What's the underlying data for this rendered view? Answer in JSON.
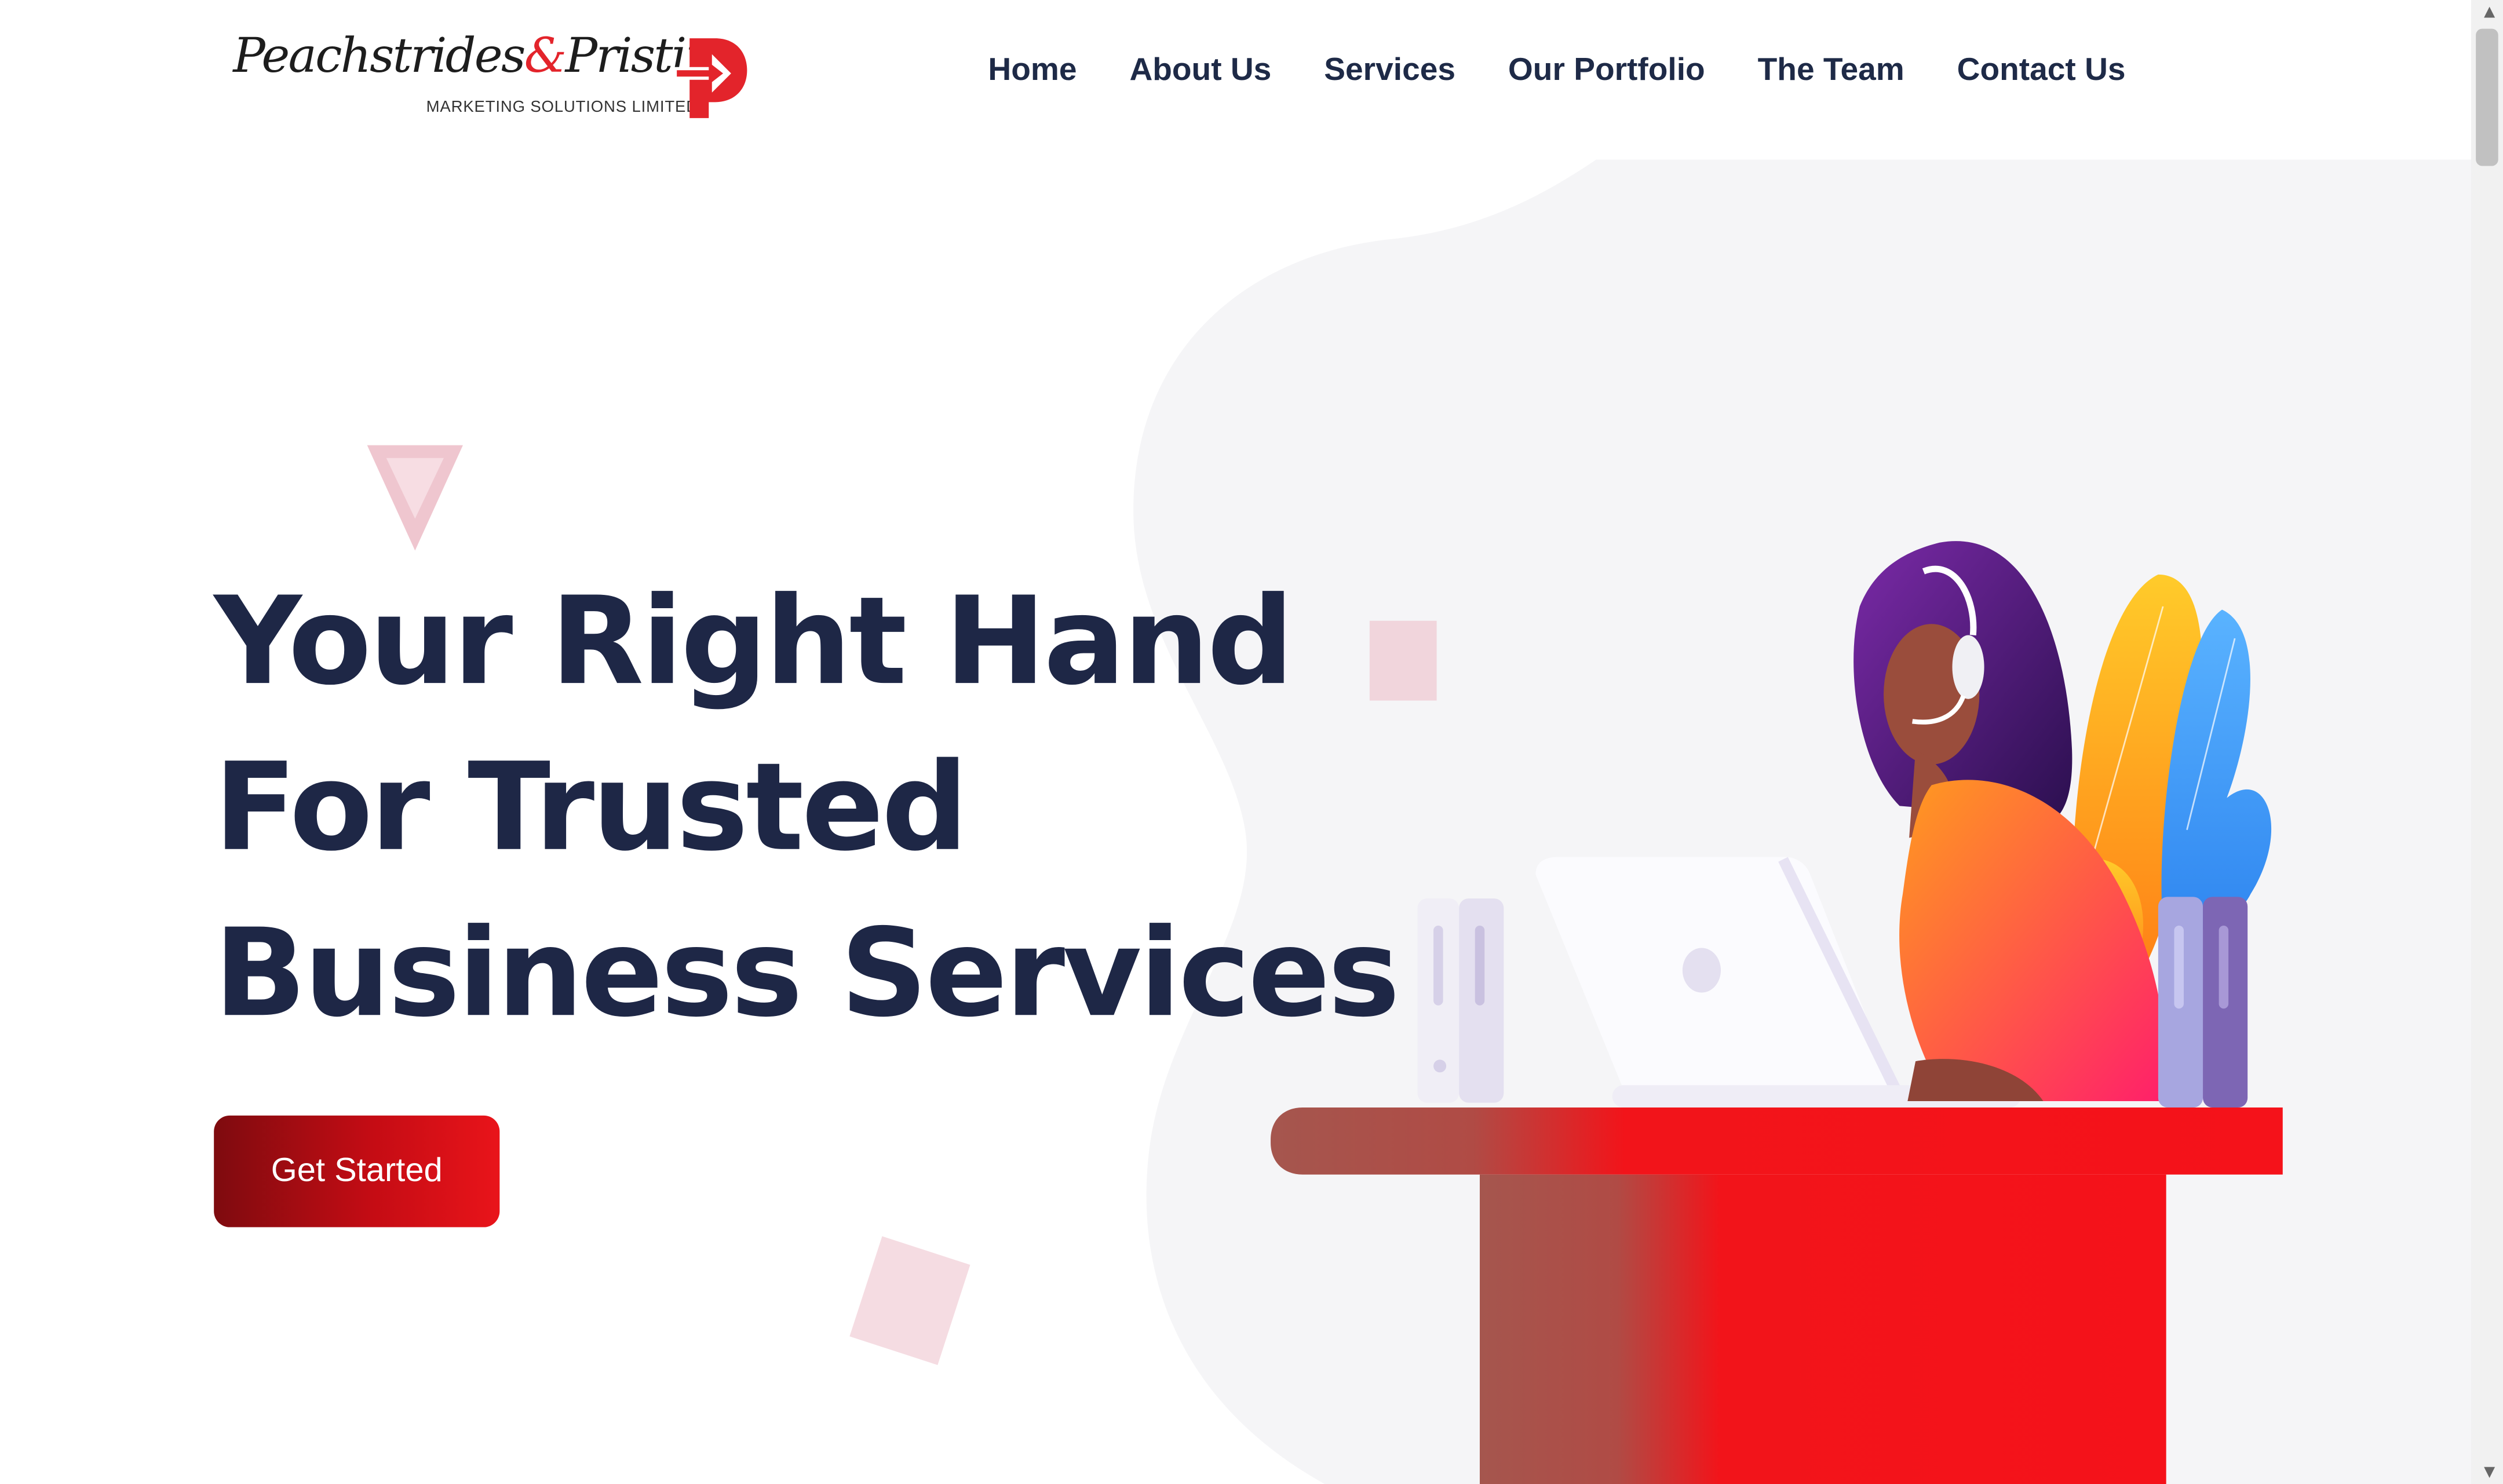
{
  "brand": {
    "name_part1": "Peachstrides",
    "ampersand": "&",
    "name_part2": "Pristine",
    "tagline": "MARKETING SOLUTIONS LIMITED",
    "accent_color": "#e3242b"
  },
  "nav": {
    "items": [
      {
        "label": "Home"
      },
      {
        "label": "About Us"
      },
      {
        "label": "Services"
      },
      {
        "label": "Our Portfolio"
      },
      {
        "label": "The Team"
      },
      {
        "label": "Contact Us"
      }
    ]
  },
  "hero": {
    "title_lines": [
      "Your Right Hand",
      "For Trusted",
      "Business Services"
    ],
    "cta_label": "Get Started",
    "text_color": "#1e2746"
  },
  "icons": [
    "logo-p-arrow-icon",
    "scroll-up-icon",
    "scroll-down-icon"
  ]
}
